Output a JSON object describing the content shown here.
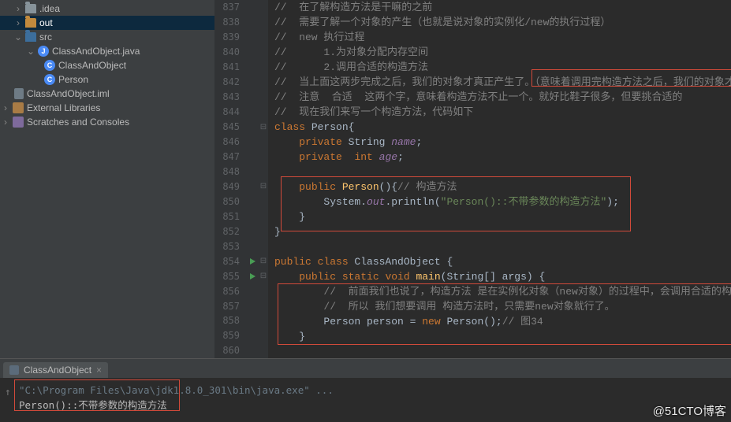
{
  "tree": {
    "idea": ".idea",
    "out": "out",
    "src": "src",
    "file_main": "ClassAndObject.java",
    "cls1": "ClassAndObject",
    "cls2": "Person",
    "iml": "ClassAndObject.iml",
    "ext": "External Libraries",
    "scratch": "Scratches and Consoles"
  },
  "lines": {
    "837": "//  在了解构造方法是干嘛的之前",
    "838": "//  需要了解一个对象的产生（也就是说对象的实例化/new的执行过程）",
    "839": "//  new 执行过程",
    "840": "//      1.为对象分配内存空间",
    "841": "//      2.调用合适的构造方法",
    "842a": "//  当上面这两步完成之后，我们的对象才真正产生了。",
    "842b": "（意味着调用完构造方法之后，我们的对象才真正产生了）",
    "843": "//  注意  合适  这两个字，意味着构造方法不止一个。就好比鞋子很多，但要挑合适的",
    "844": "//  现在我们来写一个构造方法，代码如下",
    "845_kw": "class ",
    "845_name": "Person",
    "845_tail": "{",
    "846_kw": "private ",
    "846_t": "String ",
    "846_f": "name",
    "846_s": ";",
    "847_kw": "private  ",
    "847_t": "int ",
    "847_f": "age",
    "847_s": ";",
    "849_kw": "public ",
    "849_name": "Person",
    "849_p": "(){",
    "849_c": "// 构造方法",
    "850_a": "System.",
    "850_out": "out",
    "850_b": ".println(",
    "850_s": "\"Person()::不带参数的构造方法\"",
    "850_c": ");",
    "851": "}",
    "852": "}",
    "854_kw1": "public class ",
    "854_n": "ClassAndObject ",
    "854_b": "{",
    "855_kw": "public static ",
    "855_v": "void ",
    "855_m": "main",
    "855_p": "(String[] args) {",
    "856": "//  前面我们也说了，构造方法 是在实例化对象（new对象）的过程中，会调用合适的构造方法",
    "857": "//  所以 我们想要调用 构造方法时，只需要new对象就行了。",
    "858_t": "Person ",
    "858_v": "person ",
    "858_eq": "= ",
    "858_new": "new ",
    "858_c": "Person();",
    "858_cm": "// 图34",
    "859": "}",
    "860": ""
  },
  "run": {
    "tab": "ClassAndObject",
    "exe": "\"C:\\Program Files\\Java\\jdk1.8.0_301\\bin\\java.exe\" ...",
    "out": "Person()::不带参数的构造方法"
  },
  "watermark": "@51CTO博客"
}
